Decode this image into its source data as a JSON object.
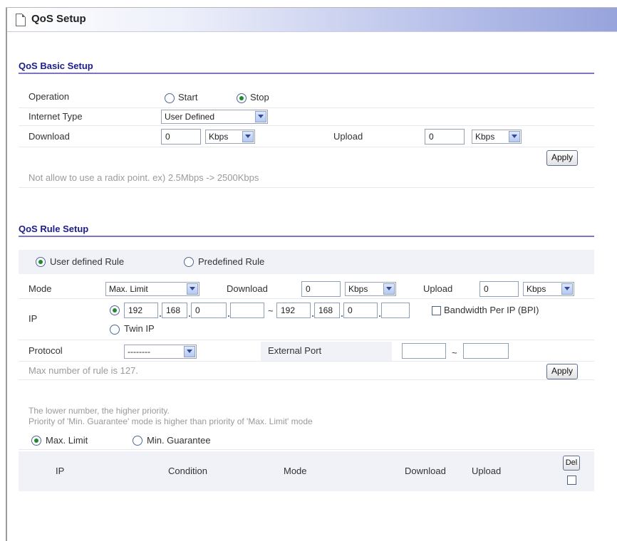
{
  "window": {
    "title": "QoS Setup",
    "icon": "document-icon"
  },
  "basic": {
    "section_title": "QoS Basic Setup",
    "operation_label": "Operation",
    "operation_start": "Start",
    "operation_stop": "Stop",
    "operation_value": "Stop",
    "internet_type_label": "Internet Type",
    "internet_type_value": "User Defined",
    "download_label": "Download",
    "download_value": "0",
    "download_unit": "Kbps",
    "upload_label": "Upload",
    "upload_value": "0",
    "upload_unit": "Kbps",
    "apply_label": "Apply",
    "note": "Not allow to use a radix point. ex) 2.5Mbps -> 2500Kbps"
  },
  "rule": {
    "section_title": "QoS Rule Setup",
    "user_defined_label": "User defined Rule",
    "predefined_label": "Predefined Rule",
    "rule_type_value": "User defined Rule",
    "mode_label": "Mode",
    "mode_value": "Max. Limit",
    "download_label": "Download",
    "download_value": "0",
    "download_unit": "Kbps",
    "upload_label": "Upload",
    "upload_value": "0",
    "upload_unit": "Kbps",
    "ip_label": "IP",
    "ip_start": [
      "192",
      "168",
      "0",
      ""
    ],
    "ip_range_sep": "~",
    "ip_end": [
      "192",
      "168",
      "0",
      ""
    ],
    "bpi_label": "Bandwidth Per IP (BPI)",
    "twin_ip_label": "Twin IP",
    "protocol_label": "Protocol",
    "protocol_value": "--------",
    "external_port_label": "External Port",
    "port_sep": "~",
    "port_from": "",
    "port_to": "",
    "max_rule_note": "Max number of rule is 127.",
    "apply_label": "Apply"
  },
  "priority": {
    "note1": "The lower number, the higher priority.",
    "note2": "Priority of 'Min. Guarantee' mode is higher than priority of 'Max. Limit' mode",
    "max_limit_label": "Max. Limit",
    "min_guarantee_label": "Min. Guarantee",
    "selected": "Max. Limit"
  },
  "rule_table": {
    "columns": [
      "IP",
      "Condition",
      "Mode",
      "Download",
      "Upload"
    ],
    "del_label": "Del",
    "rows": []
  }
}
